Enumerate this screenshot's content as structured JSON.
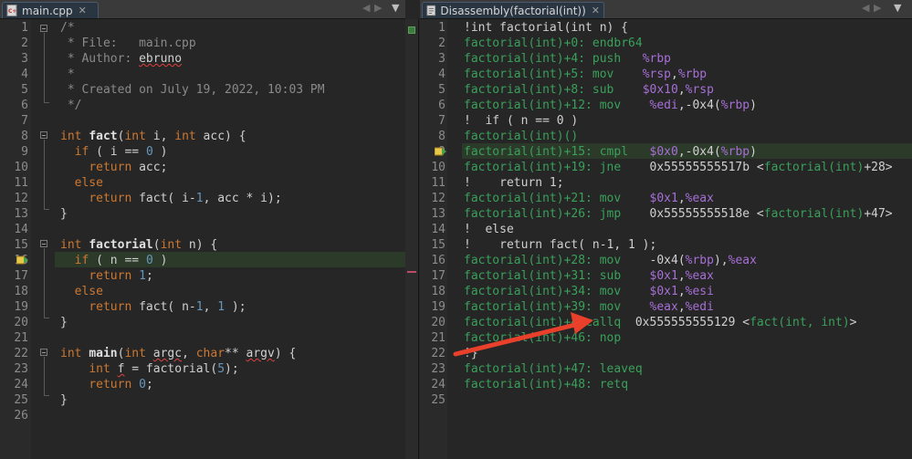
{
  "left_tab": {
    "label": "main.cpp",
    "icon": "cpp-file-icon"
  },
  "right_tab": {
    "label": "Disassembly(factorial(int))",
    "icon": "disassembly-icon"
  },
  "colors": {
    "comment": "#8a8a8a",
    "keyword": "#cc7832",
    "number": "#6897bb",
    "symbol": "#3aa05a",
    "register": "#a66fd6",
    "current_line": "#2c3a2a",
    "arrow": "#e8402a"
  },
  "source": [
    [
      [
        "comment",
        "/*"
      ]
    ],
    [
      [
        "comment",
        " * File:   main.cpp"
      ]
    ],
    [
      [
        "comment",
        " * Author: "
      ],
      [
        "squig",
        "ebruno"
      ]
    ],
    [
      [
        "comment",
        " *"
      ]
    ],
    [
      [
        "comment",
        " * Created on July 19, 2022, 10:03 PM"
      ]
    ],
    [
      [
        "comment",
        " */"
      ]
    ],
    [],
    [
      [
        "kw",
        "int "
      ],
      [
        "fn",
        "fact"
      ],
      [
        "def",
        "("
      ],
      [
        "kw",
        "int"
      ],
      [
        "def",
        " i, "
      ],
      [
        "kw",
        "int"
      ],
      [
        "def",
        " acc) {"
      ]
    ],
    [
      [
        "def",
        "  "
      ],
      [
        "kw",
        "if"
      ],
      [
        "def",
        " ( i == "
      ],
      [
        "num",
        "0"
      ],
      [
        "def",
        " )"
      ]
    ],
    [
      [
        "def",
        "    "
      ],
      [
        "kw",
        "return"
      ],
      [
        "def",
        " acc;"
      ]
    ],
    [
      [
        "def",
        "  "
      ],
      [
        "kw",
        "else"
      ]
    ],
    [
      [
        "def",
        "    "
      ],
      [
        "kw",
        "return"
      ],
      [
        "def",
        " fact( i-"
      ],
      [
        "num",
        "1"
      ],
      [
        "def",
        ", acc * i);"
      ]
    ],
    [
      [
        "def",
        "}"
      ]
    ],
    [],
    [
      [
        "kw",
        "int "
      ],
      [
        "fn",
        "factorial"
      ],
      [
        "def",
        "("
      ],
      [
        "kw",
        "int"
      ],
      [
        "def",
        " n) {"
      ]
    ],
    [
      [
        "def",
        "  "
      ],
      [
        "kw",
        "if"
      ],
      [
        "def",
        " ( n == "
      ],
      [
        "num",
        "0"
      ],
      [
        "def",
        " )"
      ]
    ],
    [
      [
        "def",
        "    "
      ],
      [
        "kw",
        "return"
      ],
      [
        "def",
        " "
      ],
      [
        "num",
        "1"
      ],
      [
        "def",
        ";"
      ]
    ],
    [
      [
        "def",
        "  "
      ],
      [
        "kw",
        "else"
      ]
    ],
    [
      [
        "def",
        "    "
      ],
      [
        "kw",
        "return"
      ],
      [
        "def",
        " fact( n-"
      ],
      [
        "num",
        "1"
      ],
      [
        "def",
        ", "
      ],
      [
        "num",
        "1"
      ],
      [
        "def",
        " );"
      ]
    ],
    [
      [
        "def",
        "}"
      ]
    ],
    [],
    [
      [
        "kw",
        "int "
      ],
      [
        "fn",
        "main"
      ],
      [
        "def",
        "("
      ],
      [
        "kw",
        "int"
      ],
      [
        "def",
        " "
      ],
      [
        "squig",
        "argc"
      ],
      [
        "def",
        ", "
      ],
      [
        "kw",
        "char"
      ],
      [
        "def",
        "** "
      ],
      [
        "squig",
        "argv"
      ],
      [
        "def",
        ") {"
      ]
    ],
    [
      [
        "def",
        "    "
      ],
      [
        "kw",
        "int"
      ],
      [
        "def",
        " "
      ],
      [
        "squig",
        "f"
      ],
      [
        "def",
        " = factorial("
      ],
      [
        "num",
        "5"
      ],
      [
        "def",
        ");"
      ]
    ],
    [
      [
        "def",
        "    "
      ],
      [
        "kw",
        "return"
      ],
      [
        "def",
        " "
      ],
      [
        "num",
        "0"
      ],
      [
        "def",
        ";"
      ]
    ],
    [
      [
        "def",
        "}"
      ]
    ],
    []
  ],
  "disasm": [
    [
      [
        "def",
        "!int factorial(int n) {"
      ]
    ],
    [
      [
        "sym",
        "factorial(int)+0: "
      ],
      [
        "mn",
        "endbr64"
      ]
    ],
    [
      [
        "sym",
        "factorial(int)+4: "
      ],
      [
        "mn",
        "push"
      ],
      [
        "def",
        "   "
      ],
      [
        "reg",
        "%rbp"
      ]
    ],
    [
      [
        "sym",
        "factorial(int)+5: "
      ],
      [
        "mn",
        "mov"
      ],
      [
        "def",
        "    "
      ],
      [
        "reg",
        "%rsp"
      ],
      [
        "def",
        ","
      ],
      [
        "reg",
        "%rbp"
      ]
    ],
    [
      [
        "sym",
        "factorial(int)+8: "
      ],
      [
        "mn",
        "sub"
      ],
      [
        "def",
        "    "
      ],
      [
        "reg",
        "$0x10"
      ],
      [
        "def",
        ","
      ],
      [
        "reg",
        "%rsp"
      ]
    ],
    [
      [
        "sym",
        "factorial(int)+12: "
      ],
      [
        "mn",
        "mov"
      ],
      [
        "def",
        "    "
      ],
      [
        "reg",
        "%edi"
      ],
      [
        "def",
        ",-0x4("
      ],
      [
        "reg",
        "%rbp"
      ],
      [
        "def",
        ")"
      ]
    ],
    [
      [
        "def",
        "!  if ( n == 0 )"
      ]
    ],
    [
      [
        "sym",
        "factorial(int)()"
      ]
    ],
    [
      [
        "sym",
        "factorial(int)+15: "
      ],
      [
        "mn",
        "cmpl"
      ],
      [
        "def",
        "   "
      ],
      [
        "reg",
        "$0x0"
      ],
      [
        "def",
        ",-0x4("
      ],
      [
        "reg",
        "%rbp"
      ],
      [
        "def",
        ")"
      ]
    ],
    [
      [
        "sym",
        "factorial(int)+19: "
      ],
      [
        "mn",
        "jne"
      ],
      [
        "def",
        "    0x55555555517b <"
      ],
      [
        "sym",
        "factorial(int)"
      ],
      [
        "def",
        "+28>"
      ]
    ],
    [
      [
        "def",
        "!    return 1;"
      ]
    ],
    [
      [
        "sym",
        "factorial(int)+21: "
      ],
      [
        "mn",
        "mov"
      ],
      [
        "def",
        "    "
      ],
      [
        "reg",
        "$0x1"
      ],
      [
        "def",
        ","
      ],
      [
        "reg",
        "%eax"
      ]
    ],
    [
      [
        "sym",
        "factorial(int)+26: "
      ],
      [
        "mn",
        "jmp"
      ],
      [
        "def",
        "    0x55555555518e <"
      ],
      [
        "sym",
        "factorial(int)"
      ],
      [
        "def",
        "+47>"
      ]
    ],
    [
      [
        "def",
        "!  else"
      ]
    ],
    [
      [
        "def",
        "!    return fact( n-1, 1 );"
      ]
    ],
    [
      [
        "sym",
        "factorial(int)+28: "
      ],
      [
        "mn",
        "mov"
      ],
      [
        "def",
        "    -0x4("
      ],
      [
        "reg",
        "%rbp"
      ],
      [
        "def",
        "),"
      ],
      [
        "reg",
        "%eax"
      ]
    ],
    [
      [
        "sym",
        "factorial(int)+31: "
      ],
      [
        "mn",
        "sub"
      ],
      [
        "def",
        "    "
      ],
      [
        "reg",
        "$0x1"
      ],
      [
        "def",
        ","
      ],
      [
        "reg",
        "%eax"
      ]
    ],
    [
      [
        "sym",
        "factorial(int)+34: "
      ],
      [
        "mn",
        "mov"
      ],
      [
        "def",
        "    "
      ],
      [
        "reg",
        "$0x1"
      ],
      [
        "def",
        ","
      ],
      [
        "reg",
        "%esi"
      ]
    ],
    [
      [
        "sym",
        "factorial(int)+39: "
      ],
      [
        "mn",
        "mov"
      ],
      [
        "def",
        "    "
      ],
      [
        "reg",
        "%eax"
      ],
      [
        "def",
        ","
      ],
      [
        "reg",
        "%edi"
      ]
    ],
    [
      [
        "sym",
        "factorial(int)+4"
      ],
      [
        "def",
        " "
      ],
      [
        "mn",
        "callq"
      ],
      [
        "def",
        "  0x555555555129 <"
      ],
      [
        "sym",
        "fact(int, int)"
      ],
      [
        "def",
        ">"
      ]
    ],
    [
      [
        "sym",
        "factorial(int)+46: "
      ],
      [
        "mn",
        "nop"
      ]
    ],
    [
      [
        "def",
        "!}"
      ]
    ],
    [
      [
        "sym",
        "factorial(int)+47: "
      ],
      [
        "mn",
        "leaveq"
      ]
    ],
    [
      [
        "sym",
        "factorial(int)+48: "
      ],
      [
        "mn",
        "retq"
      ]
    ],
    []
  ]
}
